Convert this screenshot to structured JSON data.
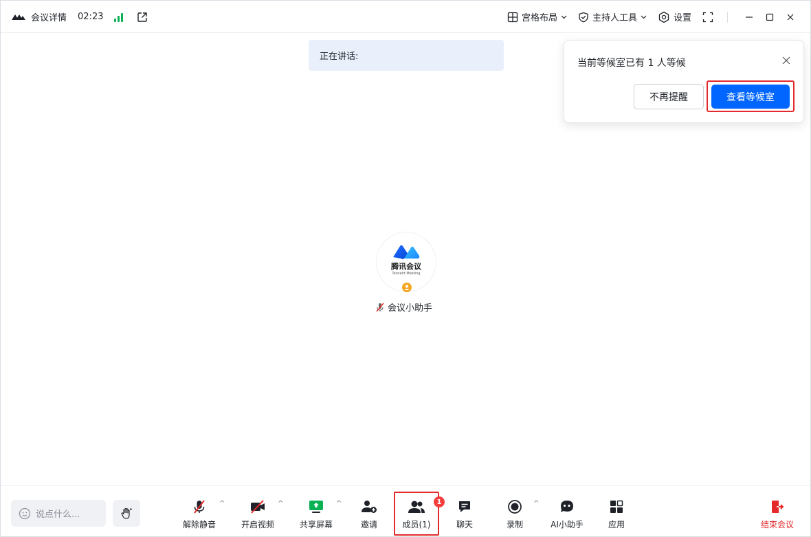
{
  "titlebar": {
    "meeting_details": "会议详情",
    "timer": "02:23",
    "layout": "宫格布局",
    "host_tools": "主持人工具",
    "settings": "设置"
  },
  "speaking": {
    "label": "正在讲话:"
  },
  "waiting_popup": {
    "message": "当前等候室已有 1 人等候",
    "dismiss": "不再提醒",
    "view": "查看等候室"
  },
  "participant": {
    "avatar_brand_cn": "腾讯会议",
    "avatar_brand_en": "Tencent Meeting",
    "name": "会议小助手"
  },
  "toolbar": {
    "chat_placeholder": "说点什么...",
    "unmute": "解除静音",
    "start_video": "开启视频",
    "share_screen": "共享屏幕",
    "invite": "邀请",
    "members": "成员(1)",
    "members_badge": "1",
    "chat": "聊天",
    "record": "录制",
    "ai_assistant": "AI小助手",
    "apps": "应用",
    "end_meeting": "结束会议"
  },
  "colors": {
    "primary": "#0066ff",
    "highlight": "#e4292c",
    "signal": "#0ab154",
    "host_badge": "#f5a623",
    "share_green": "#0ab154"
  }
}
